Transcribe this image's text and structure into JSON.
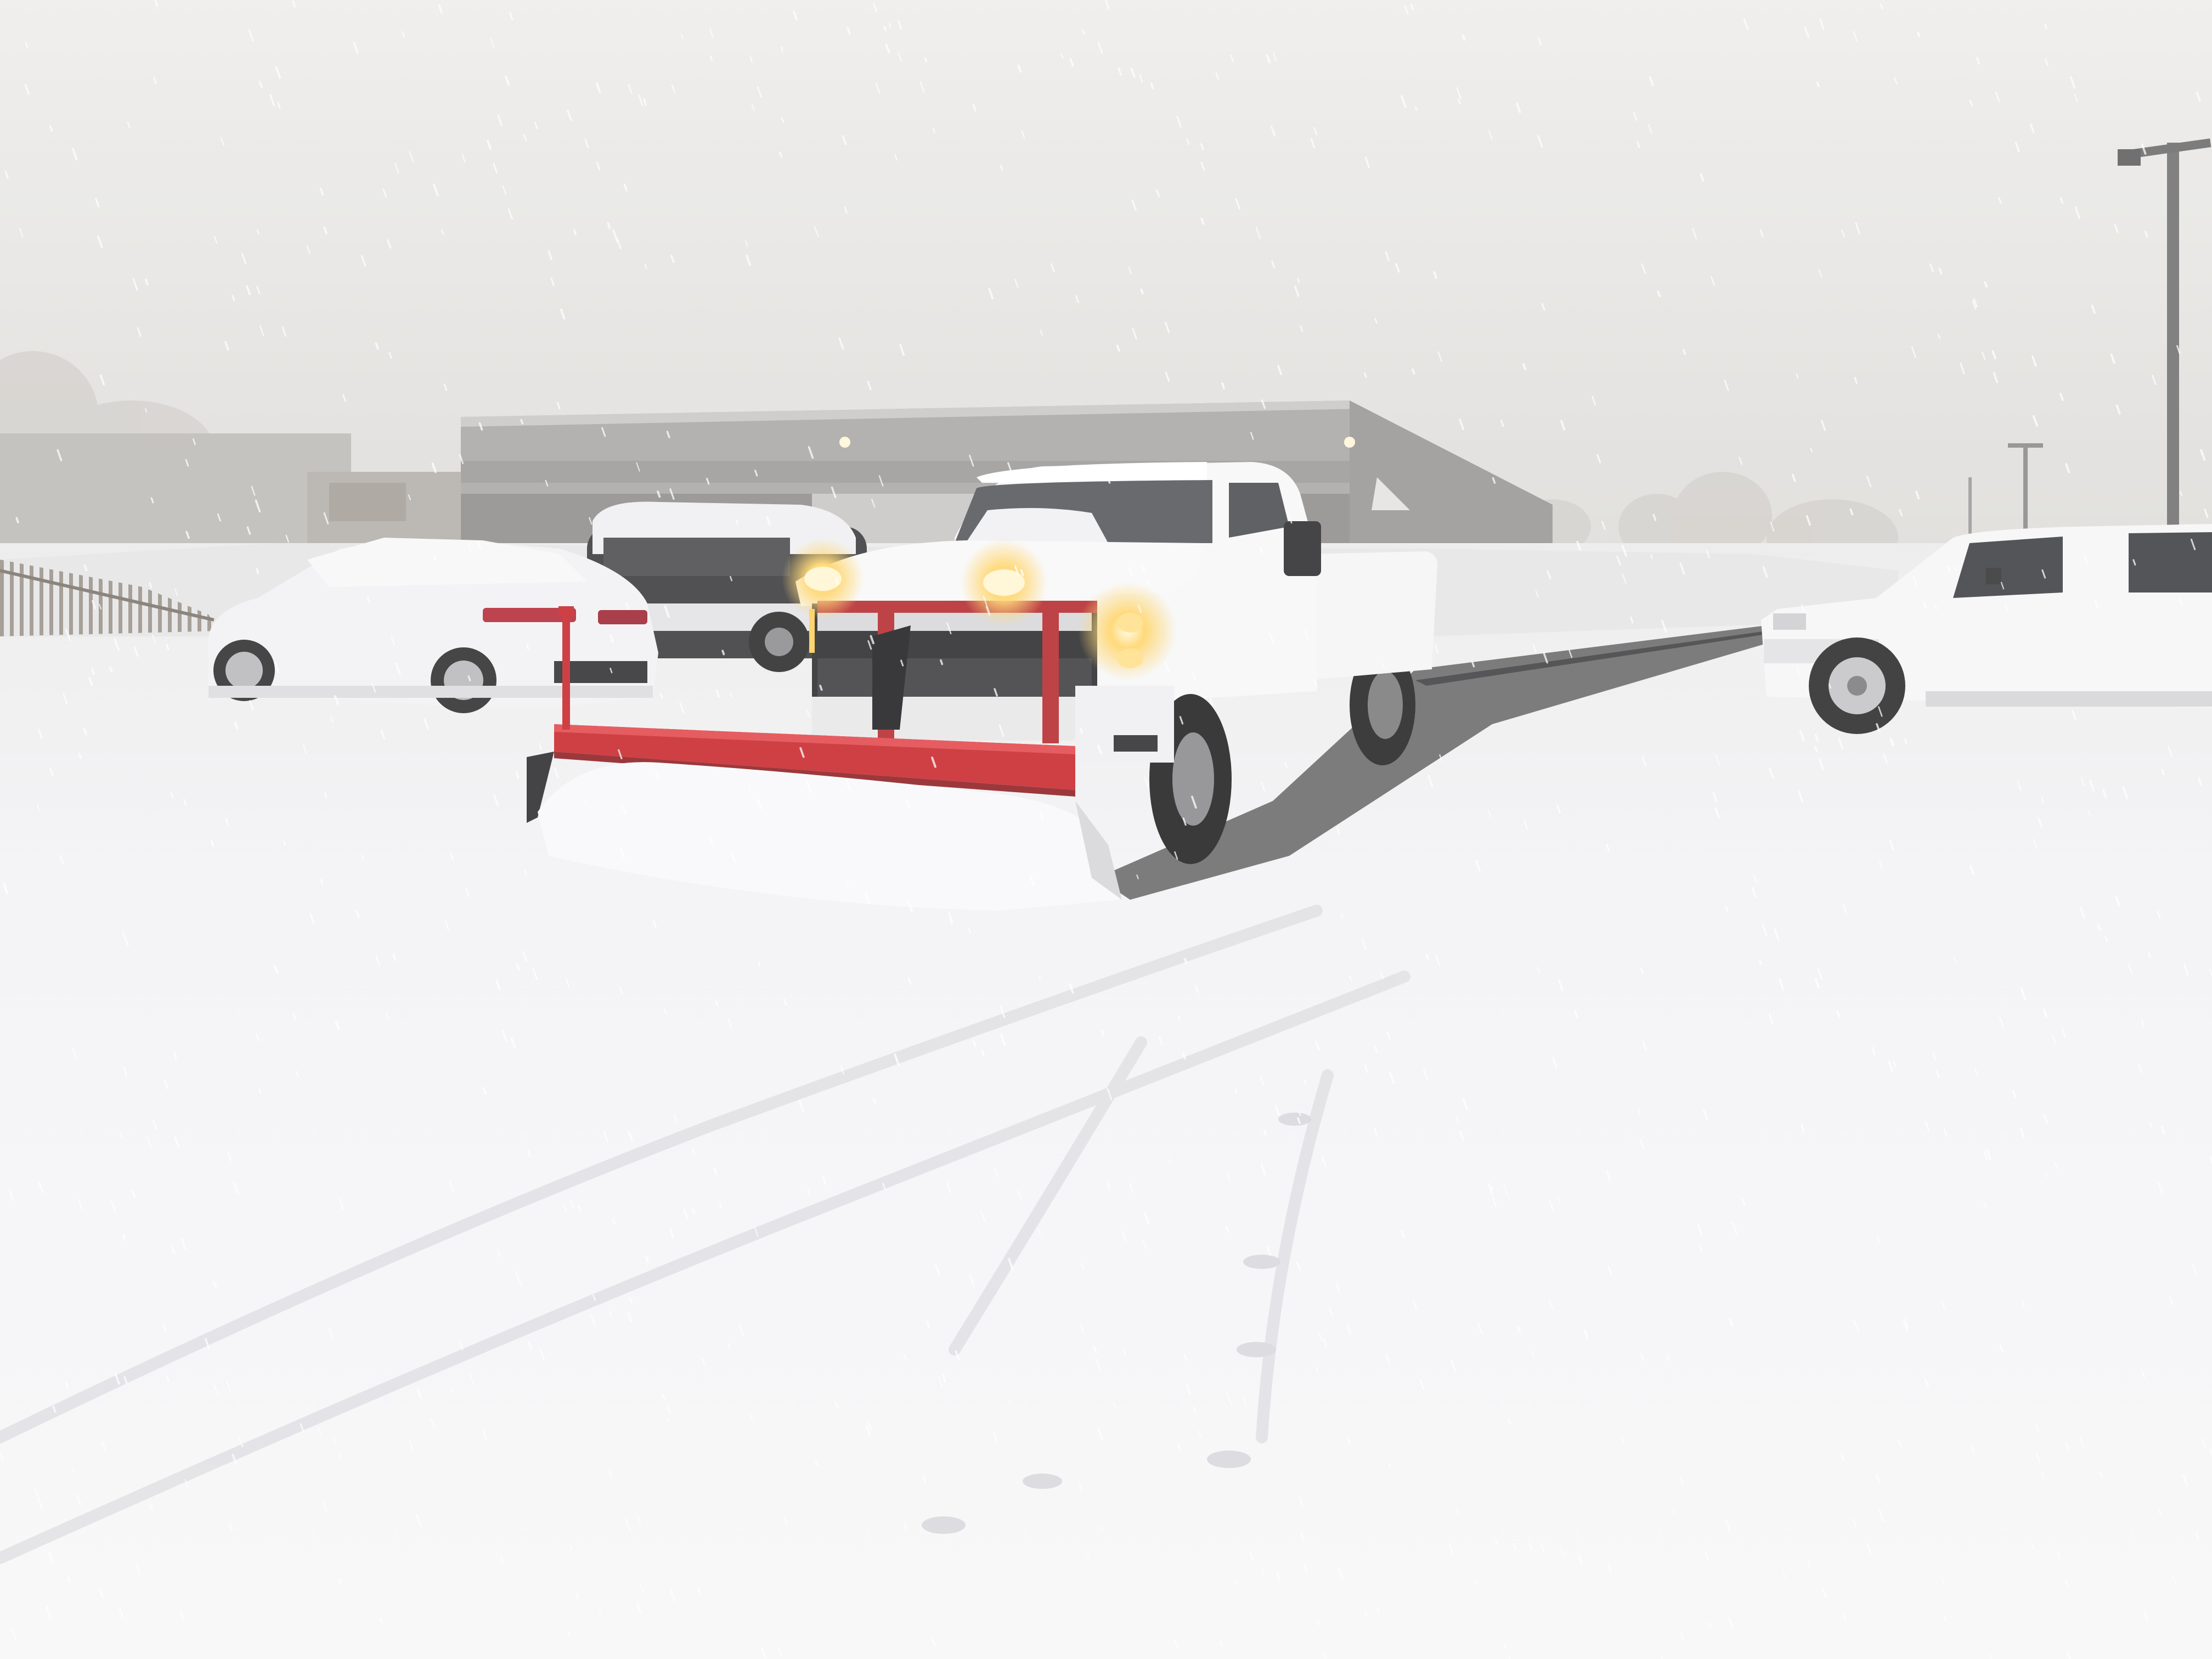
{
  "scene": {
    "kind": "photograph",
    "weather": "heavy snowfall",
    "palette": {
      "sky": "#e8e7e5",
      "snow": "#f4f4f6",
      "snow_shadow": "#dadade",
      "building": "#a9a8a6",
      "plow_red": "#c8262b",
      "headlight": "#ffd56a",
      "pavement": "#5e5e60",
      "truck_white": "#f7f7f7",
      "tire": "#2d2d2e"
    }
  },
  "objects": [
    {
      "name": "pickup-truck-with-plow"
    },
    {
      "name": "red-snow-plow-blade"
    },
    {
      "name": "parked-sedan"
    },
    {
      "name": "parked-dark-suv"
    },
    {
      "name": "parked-white-pickup"
    },
    {
      "name": "commercial-building"
    },
    {
      "name": "parking-lot-light-pole"
    },
    {
      "name": "wooden-snow-fence"
    }
  ]
}
